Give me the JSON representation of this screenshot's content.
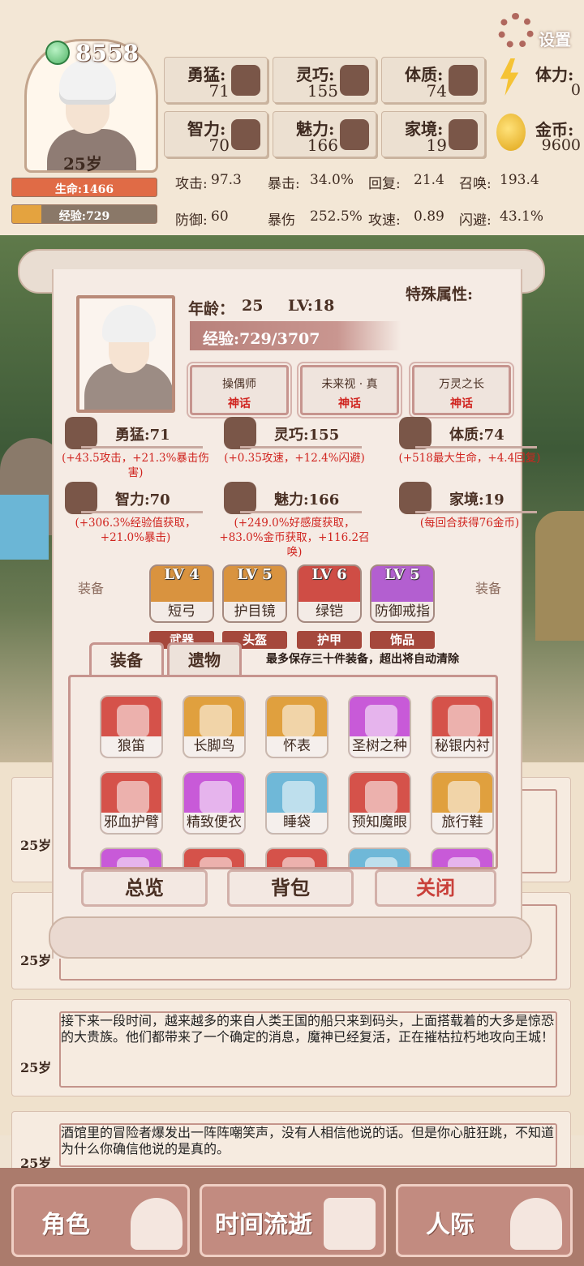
{
  "header": {
    "score": "8558",
    "age": "25岁",
    "hp_label": "生命:1466",
    "hp_fill": 1.0,
    "exp_label": "经验:729",
    "exp_fill": 0.2,
    "settings_label": "设置"
  },
  "stats": [
    {
      "label": "勇猛:",
      "value": "71",
      "icon": "fist-icon"
    },
    {
      "label": "灵巧:",
      "value": "155",
      "icon": "cloak-icon"
    },
    {
      "label": "体质:",
      "value": "74",
      "icon": "arm-icon"
    },
    {
      "label": "智力:",
      "value": "70",
      "icon": "brain-icon"
    },
    {
      "label": "魅力:",
      "value": "166",
      "icon": "flower-icon"
    },
    {
      "label": "家境:",
      "value": "19",
      "icon": "house-icon"
    }
  ],
  "resources": {
    "stamina_label": "体力:",
    "stamina_value": "0",
    "gold_label": "金币:",
    "gold_value": "9600"
  },
  "combat": [
    {
      "label": "攻击:",
      "value": "97.3"
    },
    {
      "label": "暴击:",
      "value": "34.0%"
    },
    {
      "label": "回复:",
      "value": "21.4"
    },
    {
      "label": "召唤:",
      "value": "193.4"
    },
    {
      "label": "防御:",
      "value": "60"
    },
    {
      "label": "暴伤",
      "value": "252.5%"
    },
    {
      "label": "攻速:",
      "value": "0.89"
    },
    {
      "label": "闪避:",
      "value": "43.1%"
    }
  ],
  "modal": {
    "age_label": "年龄：",
    "age_value": "25",
    "level": "LV:18",
    "special_label": "特殊属性:",
    "exp_text": "经验:729/3707",
    "traits": [
      {
        "name": "操偶师",
        "rarity": "神话"
      },
      {
        "name": "未来视 · 真",
        "rarity": "神话"
      },
      {
        "name": "万灵之长",
        "rarity": "神话"
      }
    ],
    "attributes": [
      {
        "name": "勇猛:71",
        "effect": "(+43.5攻击，+21.3%暴击伤害)",
        "icon": "fist-icon"
      },
      {
        "name": "灵巧:155",
        "effect": "(+0.35攻速，+12.4%闪避)",
        "icon": "cloak-icon"
      },
      {
        "name": "体质:74",
        "effect": "(+518最大生命，+4.4回复)",
        "icon": "arm-icon"
      },
      {
        "name": "智力:70",
        "effect": "(+306.3%经验值获取，+21.0%暴击)",
        "icon": "brain-icon"
      },
      {
        "name": "魅力:166",
        "effect": "(+249.0%好感度获取，+83.0%金币获取，+116.2召唤)",
        "icon": "flower-icon"
      },
      {
        "name": "家境:19",
        "effect": "(每回合获得76金币)",
        "icon": "house-icon"
      }
    ],
    "equip_side_label": "装备",
    "equipment": [
      {
        "lv": "LV 4",
        "name": "短弓",
        "type": "武器",
        "color": "#d9933f"
      },
      {
        "lv": "LV 5",
        "name": "护目镜",
        "type": "头盔",
        "color": "#d9933f"
      },
      {
        "lv": "LV 6",
        "name": "绿铠",
        "type": "护甲",
        "color": "#cf4d45"
      },
      {
        "lv": "LV 5",
        "name": "防御戒指",
        "type": "饰品",
        "color": "#b35fd0"
      }
    ],
    "tabs": [
      "装备",
      "遗物"
    ],
    "notice": "最多保存三十件装备，超出将自动清除",
    "items": [
      {
        "name": "狼笛",
        "color": "#d5524a",
        "icon": "wolf-skull-icon"
      },
      {
        "name": "长脚鸟",
        "color": "#e0a03e",
        "icon": "bird-icon"
      },
      {
        "name": "怀表",
        "color": "#e0a03e",
        "icon": "pocket-watch-icon"
      },
      {
        "name": "圣树之种",
        "color": "#c85ad8",
        "icon": "seed-icon"
      },
      {
        "name": "秘银内衬",
        "color": "#d5524a",
        "icon": "vest-icon"
      },
      {
        "name": "邪血护臂",
        "color": "#d5524a",
        "icon": "bracer-icon"
      },
      {
        "name": "精致便衣",
        "color": "#c85ad8",
        "icon": "coat-icon"
      },
      {
        "name": "睡袋",
        "color": "#6fb8d8",
        "icon": "sleeping-bag-icon"
      },
      {
        "name": "预知魔眼",
        "color": "#d5524a",
        "icon": "eye-icon"
      },
      {
        "name": "旅行鞋",
        "color": "#e0a03e",
        "icon": "boot-icon"
      },
      {
        "name": "",
        "color": "#c85ad8",
        "icon": "item-icon"
      },
      {
        "name": "",
        "color": "#d5524a",
        "icon": "item-icon"
      },
      {
        "name": "",
        "color": "#d5524a",
        "icon": "item-icon"
      },
      {
        "name": "",
        "color": "#6fb8d8",
        "icon": "item-icon"
      },
      {
        "name": "",
        "color": "#c85ad8",
        "icon": "item-icon"
      }
    ],
    "buttons": {
      "overview": "总览",
      "bag": "背包",
      "close": "关闭"
    }
  },
  "logs": [
    {
      "age": "25岁",
      "text": ""
    },
    {
      "age": "25岁",
      "text": ""
    },
    {
      "age": "25岁",
      "text": "接下来一段时间，越来越多的来自人类王国的船只来到码头，上面搭载着的大多是惊恐的大贵族。他们都带来了一个确定的消息，魔神已经复活，正在摧枯拉朽地攻向王城！"
    },
    {
      "age": "25岁",
      "text": "酒馆里的冒险者爆发出一阵阵嘲笑声，没有人相信他说的话。但是你心脏狂跳，不知道为什么你确信他说的是真的。"
    }
  ],
  "nav": {
    "role": "角色",
    "time": "时间流逝",
    "social": "人际"
  }
}
